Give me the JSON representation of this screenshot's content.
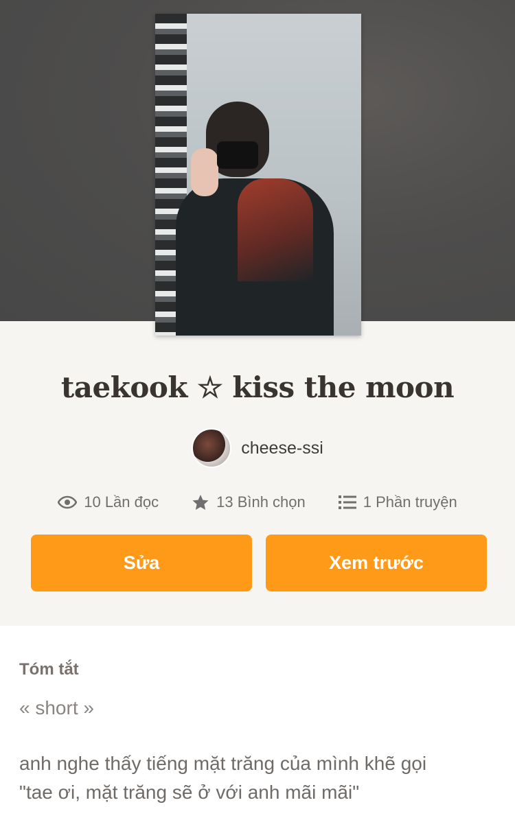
{
  "story": {
    "title": "taekook ☆ kiss the moon",
    "author": "cheese-ssi"
  },
  "stats": {
    "reads": "10 Lần đọc",
    "votes": "13 Bình chọn",
    "parts": "1 Phần truyện"
  },
  "actions": {
    "edit_label": "Sửa",
    "preview_label": "Xem trước"
  },
  "summary": {
    "heading": "Tóm tắt",
    "tag": "« short »",
    "line1": "anh nghe thấy tiếng mặt trăng của mình khẽ gọi",
    "line2": "\"tae ơi, mặt trăng sẽ ở với anh mãi mãi\""
  },
  "colors": {
    "accent": "#ff9a19",
    "background": "#f6f5f1",
    "hero": "#4e4d4c"
  },
  "icons": {
    "reads": "eye-icon",
    "votes": "star-icon",
    "parts": "list-icon"
  }
}
